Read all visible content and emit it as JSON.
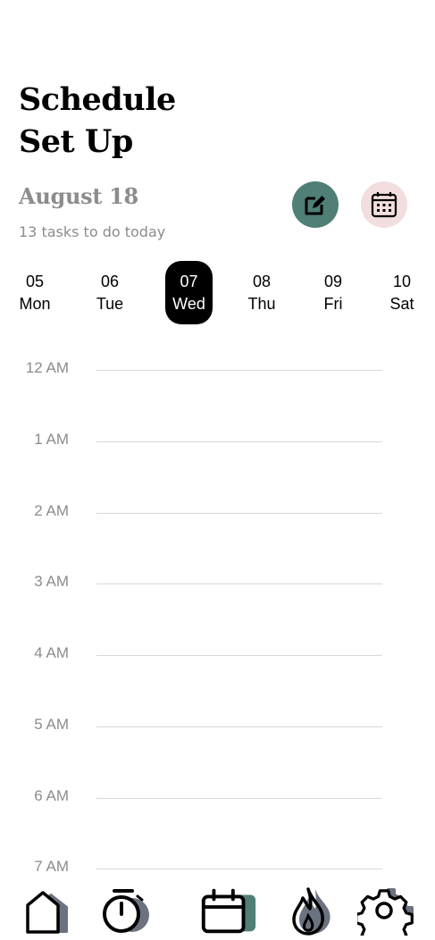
{
  "header": {
    "title_line1": "Schedule",
    "title_line2": "Set Up",
    "date": "August 18",
    "tasks_summary": "13 tasks to do today"
  },
  "actions": {
    "edit_icon": "edit-icon",
    "calendar_icon": "calendar-icon",
    "edit_color": "#4f7f76",
    "calendar_color": "#f2dede"
  },
  "week": {
    "days": [
      {
        "num": "05",
        "name": "Mon",
        "selected": false
      },
      {
        "num": "06",
        "name": "Tue",
        "selected": false
      },
      {
        "num": "07",
        "name": "Wed",
        "selected": true
      },
      {
        "num": "08",
        "name": "Thu",
        "selected": false
      },
      {
        "num": "09",
        "name": "Fri",
        "selected": false
      },
      {
        "num": "10",
        "name": "Sat",
        "selected": false
      }
    ],
    "selected_color": "#000000"
  },
  "timeline": {
    "hours": [
      "12 AM",
      "1 AM",
      "2 AM",
      "3 AM",
      "4 AM",
      "5 AM",
      "6 AM",
      "7 AM"
    ]
  },
  "nav": {
    "items": [
      {
        "icon": "home-icon"
      },
      {
        "icon": "timer-icon"
      },
      {
        "icon": "calendar-icon"
      },
      {
        "icon": "flame-icon"
      },
      {
        "icon": "settings-icon"
      }
    ],
    "accent_color": "#4f7f76",
    "shadow_color": "#6b7280"
  }
}
